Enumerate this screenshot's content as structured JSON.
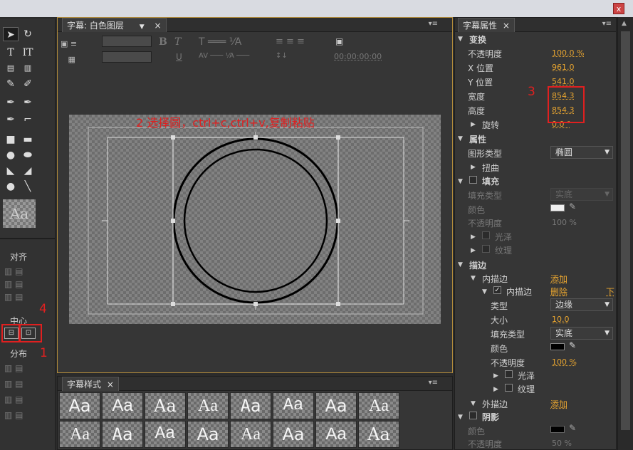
{
  "window": {
    "close_glyph": "x"
  },
  "title_panel": {
    "tab_label": "字幕: 白色图层",
    "timecode": "00:00:00:00",
    "annotation": "2 选择圆，ctrl+c,ctrl+v,复制粘贴"
  },
  "toolbox": {
    "align_label": "对齐",
    "center_label": "中心",
    "distribute_label": "分布",
    "annotation_4": "4",
    "annotation_1": "1"
  },
  "properties": {
    "tab_label": "字幕属性",
    "annotation_3": "3",
    "transform": {
      "header": "变换",
      "opacity_label": "不透明度",
      "opacity_value": "100.0 %",
      "x_label": "X 位置",
      "x_value": "961.0",
      "y_label": "Y 位置",
      "y_value": "541.0",
      "width_label": "宽度",
      "width_value": "854.3",
      "height_label": "高度",
      "height_value": "854.3",
      "rotation_label": "旋转",
      "rotation_value": "0.0 °"
    },
    "attributes": {
      "header": "属性",
      "shape_label": "图形类型",
      "shape_value": "椭圆",
      "distort_label": "扭曲"
    },
    "fill": {
      "header": "填充",
      "type_label": "填充类型",
      "type_value": "实底",
      "color_label": "颜色",
      "opacity_label": "不透明度",
      "opacity_value": "100 %",
      "sheen_label": "光泽",
      "texture_label": "纹理"
    },
    "stroke": {
      "header": "描边",
      "inner_label": "内描边",
      "inner_add": "添加",
      "inner_item_label": "内描边",
      "inner_delete": "删除",
      "inner_down": "下",
      "type_label": "类型",
      "type_value": "边缘",
      "size_label": "大小",
      "size_value": "10.0",
      "fill_type_label": "填充类型",
      "fill_type_value": "实底",
      "color_label": "颜色",
      "opacity_label": "不透明度",
      "opacity_value": "100 %",
      "sheen_label": "光泽",
      "texture_label": "纹理",
      "outer_label": "外描边",
      "outer_add": "添加"
    },
    "shadow": {
      "header": "阴影",
      "color_label": "颜色",
      "opacity_label": "不透明度",
      "opacity_value": "50 %"
    }
  },
  "styles_panel": {
    "tab_label": "字幕样式",
    "sample": "Aa"
  }
}
